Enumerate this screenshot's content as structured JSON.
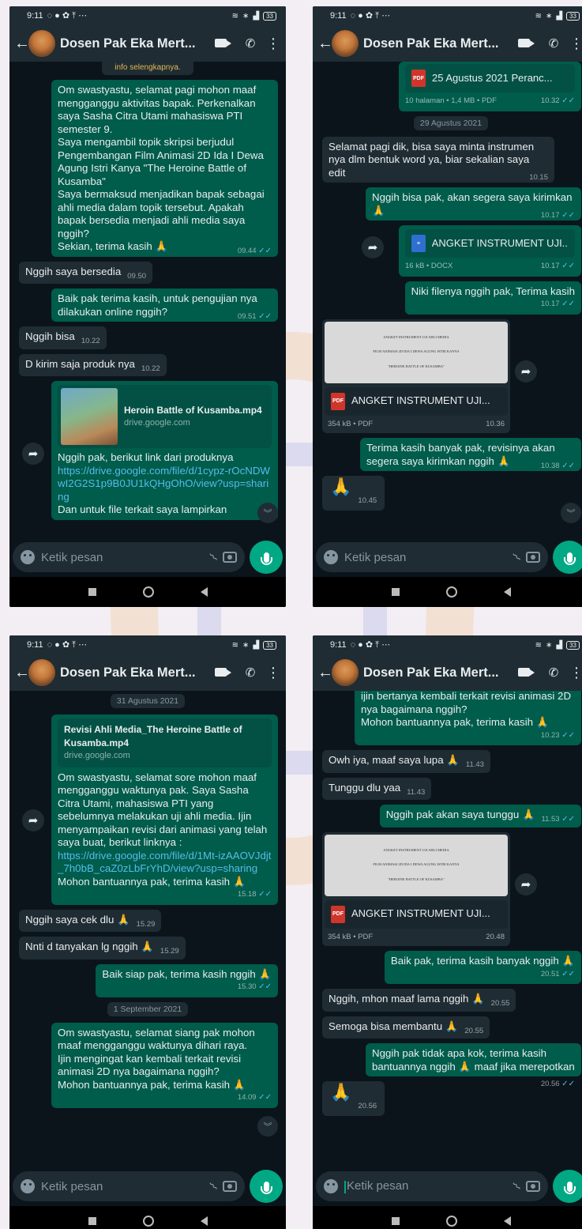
{
  "status": {
    "time": "9:11",
    "battery": "33"
  },
  "header": {
    "title": "Dosen Pak Eka Mert..."
  },
  "input": {
    "placeholder": "Ketik pesan"
  },
  "p1": {
    "note": "info selengkapnya.",
    "m1": "Om swastyastu, selamat pagi mohon maaf mengganggu aktivitas bapak. Perkenalkan saya Sasha Citra Utami mahasiswa PTI semester 9.",
    "m1b": "Saya mengambil topik skripsi berjudul Pengembangan Film Animasi 2D Ida I Dewa Agung Istri Kanya \"The Heroine Battle of Kusamba\"",
    "m1c": "Saya bermaksud menjadikan bapak sebagai ahli media dalam topik tersebut. Apakah bapak bersedia menjadi ahli media saya nggih?",
    "m1d": "Sekian, terima kasih 🙏",
    "m1t": "09.44",
    "m2": "Nggih saya bersedia",
    "m2t": "09.50",
    "m3": "Baik pak terima kasih, untuk pengujian nya dilakukan online nggih?",
    "m3t": "09.51",
    "m4": "Nggih bisa",
    "m4t": "10.22",
    "m5": "D kirim saja produk nya",
    "m5t": "10.22",
    "lc_title": "Heroin Battle of Kusamba.mp4",
    "lc_sub": "drive.google.com",
    "m6a": "Nggih pak, berikut link dari produknya",
    "m6link": "https://drive.google.com/file/d/1cypz-rOcNDWwI2G2S1p9B0JU1kQHgOhO/view?usp=sharing",
    "m6b": "Dan untuk file terkait saya lampirkan"
  },
  "p2": {
    "doc0": "25 Agustus 2021 Peranc...",
    "doc0meta": "10 halaman • 1,4 MB • PDF",
    "doc0t": "10.32",
    "date1": "29 Agustus 2021",
    "m1": "Selamat pagi dik, bisa saya minta instrumen nya dlm bentuk word ya, biar sekalian saya edit",
    "m1t": "10.15",
    "m2": "Nggih bisa pak, akan segera saya kirimkan 🙏",
    "m2t": "10.17",
    "doc1": "ANGKET INSTRUMENT UJI...",
    "doc1meta": "16 kB • DOCX",
    "doc1t": "10.17",
    "m3": "Niki filenya nggih pak, Terima kasih",
    "m3t": "10.17",
    "doc2": "ANGKET INSTRUMENT UJI...",
    "doc2meta": "354 kB • PDF",
    "doc2t": "10.36",
    "m4": "Terima kasih banyak pak, revisinya akan segera saya kirimkan nggih 🙏",
    "m4t": "10.38",
    "m5": "🙏",
    "m5t": "10.45"
  },
  "p3": {
    "date1": "31 Agustus 2021",
    "lc_title": "Revisi Ahli Media_The Heroine Battle of Kusamba.mp4",
    "lc_sub": "drive.google.com",
    "m1a": "Om swastyastu, selamat sore mohon maaf mengganggu waktunya pak. Saya Sasha Citra Utami, mahasiswa PTI yang sebelumnya melakukan uji ahli media. Ijin menyampaikan revisi dari animasi yang telah saya buat, berikut linknya :",
    "m1link": "https://drive.google.com/file/d/1Mt-izAAOVJdjt_7h0bB_caZ0zLbFrYhD/view?usp=sharing",
    "m1b": "Mohon bantuannya pak, terima kasih 🙏",
    "m1t": "15.18",
    "m2": "Nggih saya cek dlu 🙏",
    "m2t": "15.29",
    "m3": "Nnti d tanyakan lg nggih 🙏",
    "m3t": "15.29",
    "m4": "Baik siap pak, terima kasih nggih 🙏",
    "m4t": "15.30",
    "date2": "1 September 2021",
    "m5a": "Om swastyastu, selamat siang pak mohon maaf mengganggu waktunya dihari raya.",
    "m5b": "Ijin mengingat kan kembali terkait revisi animasi 2D nya bagaimana nggih?",
    "m5c": "Mohon bantuannya pak, terima kasih 🙏",
    "m5t": "14.09"
  },
  "p4": {
    "m0a": "ijin bertanya kembali terkait revisi animasi 2D nya bagaimana nggih?",
    "m0b": "Mohon bantuannya pak, terima kasih 🙏",
    "m0t": "10.23",
    "m1": "Owh iya, maaf saya lupa 🙏",
    "m1t": "11.43",
    "m2": "Tunggu dlu yaa",
    "m2t": "11.43",
    "m3": "Nggih pak akan saya tunggu 🙏",
    "m3t": "11.53",
    "doc1": "ANGKET INSTRUMENT UJI...",
    "doc1meta": "354 kB • PDF",
    "doc1t": "20.48",
    "m4": "Baik pak, terima kasih banyak nggih 🙏",
    "m4t": "20.51",
    "m5": "Nggih, mhon maaf lama nggih 🙏",
    "m5t": "20.55",
    "m6": "Semoga bisa membantu 🙏",
    "m6t": "20.55",
    "m7": "Nggih pak tidak apa kok, terima kasih bantuannya nggih 🙏 maaf jika merepotkan",
    "m7t": "20.56",
    "m8": "🙏",
    "m8t": "20.56"
  },
  "preview": {
    "l1": "ANGKET INSTRUMENT UJI AHLI MEDIA",
    "l2": "FILM ANIMASI 2D IDA I DEWA AGUNG ISTRI KANYA",
    "l3": "\"HEROINE BATTLE OF KUSAMBA\""
  },
  "colors": {
    "bg": "#0b141a",
    "bar": "#1f2c33",
    "outgoing": "#005c4b",
    "accent": "#00a884",
    "tick": "#53bdeb"
  }
}
